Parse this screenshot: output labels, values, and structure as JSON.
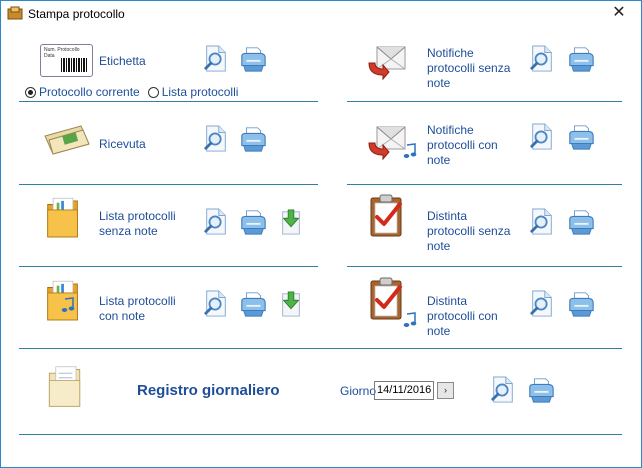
{
  "window": {
    "title": "Stampa protocollo",
    "close_glyph": "✕"
  },
  "left": {
    "etichetta": {
      "label": "Etichetta",
      "card_text_1": "Num. Protocollo",
      "card_text_2": "Data"
    },
    "radio": {
      "option1": "Protocollo corrente",
      "option2": "Lista protocolli",
      "selected": "Protocollo corrente"
    },
    "ricevuta": {
      "label": "Ricevuta"
    },
    "lista_senza_note": {
      "label_line1": "Lista protocolli",
      "label_line2": "senza note"
    },
    "lista_con_note": {
      "label_line1": "Lista protocolli",
      "label_line2": "con note"
    }
  },
  "right": {
    "notifiche_senza_note": {
      "line1": "Notifiche",
      "line2": "protocolli senza",
      "line3": "note"
    },
    "notifiche_con_note": {
      "line1": "Notifiche",
      "line2": "protocolli con",
      "line3": "note"
    },
    "distinta_senza_note": {
      "line1": "Distinta",
      "line2": "protocolli senza",
      "line3": "note"
    },
    "distinta_con_note": {
      "line1": "Distinta",
      "line2": "protocolli con",
      "line3": "note"
    }
  },
  "registro": {
    "label": "Registro giornaliero",
    "giorno_label": "Giorno",
    "date": "14/11/2016",
    "next_glyph": "›"
  },
  "icons": {
    "preview": "magnifier-document-icon",
    "print": "printer-icon",
    "export": "download-arrow-icon"
  },
  "colors": {
    "label": "#1e4e99",
    "divider": "#2e7fa4",
    "border": "#2a8ac8"
  }
}
